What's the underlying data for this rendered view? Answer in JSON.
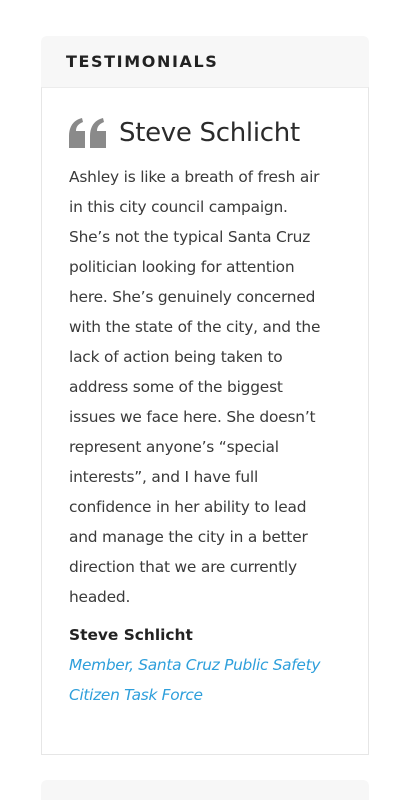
{
  "widget": {
    "title": "TESTIMONIALS"
  },
  "testimonial": {
    "icon": "quote-icon",
    "heading": "Steve Schlicht",
    "quote_lines": [
      "Ashley is like a breath of fresh air",
      "in this city council campaign.",
      "She’s not the typical Santa Cruz",
      "politician looking for attention",
      "here. She’s genuinely concerned",
      "with the state of the city, and the",
      "lack of action being taken to",
      "address some of the biggest",
      "issues we face here. She doesn’t",
      "represent anyone’s “special",
      "interests”, and I have full",
      "confidence in her ability to lead",
      "and manage the city in a better",
      "direction that we are currently",
      "headed."
    ],
    "author_name": "Steve Schlicht",
    "author_role_lines": [
      "Member, Santa Cruz Public Safety",
      "Citizen Task Force"
    ]
  },
  "colors": {
    "link": "#2e9fdb",
    "header_bg": "#f7f7f7",
    "icon": "#8a8a8a"
  }
}
